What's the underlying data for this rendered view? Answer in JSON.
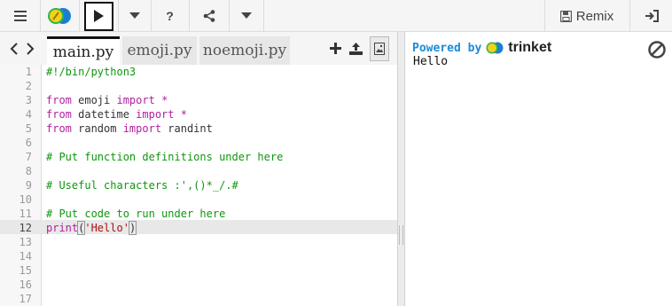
{
  "toolbar": {
    "menu_icon": "hamburger-icon",
    "logo_icon": "trinket-logo-icon",
    "run_icon": "play-icon",
    "caret_icon": "chevron-down-icon",
    "help_label": "?",
    "share_icon": "share-icon",
    "remix_label": "Remix",
    "remix_icon": "save-icon",
    "login_icon": "sign-in-icon"
  },
  "tabs": [
    {
      "label": "main.py",
      "active": true
    },
    {
      "label": "emoji.py",
      "active": false
    },
    {
      "label": "noemoji.py",
      "active": false
    }
  ],
  "editor": {
    "line_numbers": [
      "1",
      "2",
      "3",
      "4",
      "5",
      "6",
      "7",
      "8",
      "9",
      "10",
      "11",
      "12",
      "13",
      "14",
      "15",
      "16",
      "17"
    ],
    "current_line": 12,
    "code": {
      "l1": "#!/bin/python3",
      "l3_kw1": "from",
      "l3_mod": " emoji ",
      "l3_kw2": "import",
      "l3_star": " *",
      "l4_kw1": "from",
      "l4_mod": " datetime ",
      "l4_kw2": "import",
      "l4_star": " *",
      "l5_kw1": "from",
      "l5_mod": " random ",
      "l5_kw2": "import",
      "l5_name": " randint",
      "l7": "# Put function definitions under here",
      "l9": "# Useful characters :',()*_/.#",
      "l11": "# Put code to run under here",
      "l12_kw": "print",
      "l12_open": "(",
      "l12_str": "'Hello'",
      "l12_close": ")"
    }
  },
  "output": {
    "powered_by": "Powered by",
    "brand": "trinket",
    "text": "Hello"
  },
  "colors": {
    "keyword": "#b0209e",
    "comment": "#119611",
    "string": "#aa1111",
    "powered": "#1e8ad6"
  }
}
